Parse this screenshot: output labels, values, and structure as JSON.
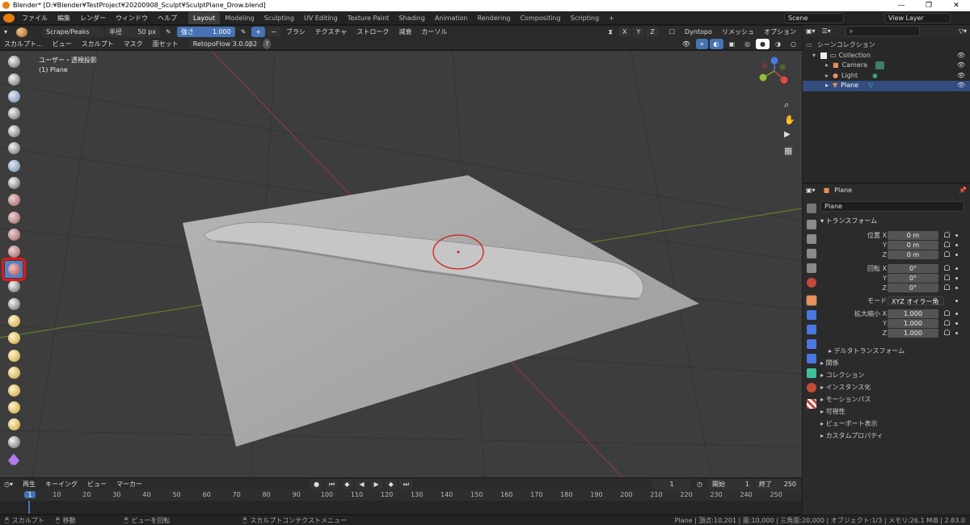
{
  "window": {
    "title": "Blender* [D:¥Blender¥TestProject¥20200908_Sculpt¥SculptPlane_Drow.blend]"
  },
  "menus": [
    "ファイル",
    "編集",
    "レンダー",
    "ウィンドウ",
    "ヘルプ"
  ],
  "workspaces": [
    "Layout",
    "Modeling",
    "Sculpting",
    "UV Editing",
    "Texture Paint",
    "Shading",
    "Animation",
    "Rendering",
    "Compositing",
    "Scripting"
  ],
  "active_workspace": "Layout",
  "scene": "Scene",
  "view_layer": "View Layer",
  "tool_header": {
    "brush": "Scrape/Peaks",
    "radius_label": "半径",
    "radius_value": "50 px",
    "strength_label": "強さ",
    "strength_value": "1.000",
    "plus": "+",
    "minus": "−",
    "menus": [
      "ブラシ",
      "テクスチャ",
      "ストローク",
      "減衰",
      "カーソル"
    ],
    "axes": [
      "X",
      "Y",
      "Z"
    ],
    "dyntopo": "Dyntopo",
    "remesh": "リメッシュ",
    "options": "オプション"
  },
  "viewport_header": {
    "mode": "スカルプト...",
    "menus": [
      "ビュー",
      "スカルプト",
      "マスク",
      "面セット"
    ],
    "addon": "RetopoFlow 3.0.0β2",
    "help": "?"
  },
  "overlay": {
    "view_name": "ユーザー・透視投影",
    "object": "(1) Plane"
  },
  "outliner": {
    "search_placeholder": "",
    "root": "シーンコレクション",
    "collection": "Collection",
    "items": [
      "Camera",
      "Light",
      "Plane"
    ],
    "selected": "Plane"
  },
  "properties": {
    "object_name": "Plane",
    "data_name": "Plane",
    "transform_title": "トランスフォーム",
    "location_label": "位置 X",
    "location": [
      "0 m",
      "0 m",
      "0 m"
    ],
    "rotation_label": "回転 X",
    "rotation": [
      "0°",
      "0°",
      "0°"
    ],
    "axis_y": "Y",
    "axis_z": "Z",
    "mode_label": "モード",
    "mode_value": "XYZ オイラー角",
    "scale_label": "拡大縮小 X",
    "scale": [
      "1.000",
      "1.000",
      "1.000"
    ],
    "delta": "デルタトランスフォーム",
    "panels": [
      "関係",
      "コレクション",
      "インスタンス化",
      "モーションパス",
      "可視性",
      "ビューポート表示",
      "カスタムプロパティ"
    ]
  },
  "timeline": {
    "menus": [
      "再生",
      "キーイング",
      "ビュー",
      "マーカー"
    ],
    "current_frame": "1",
    "start_label": "開始",
    "start": "1",
    "end_label": "終了",
    "end": "250",
    "ticks": [
      "1",
      "10",
      "20",
      "30",
      "40",
      "50",
      "60",
      "70",
      "80",
      "90",
      "100",
      "110",
      "120",
      "130",
      "140",
      "150",
      "160",
      "170",
      "180",
      "190",
      "200",
      "210",
      "220",
      "230",
      "240",
      "250"
    ]
  },
  "status": {
    "left": [
      "スカルプト",
      "移動",
      "ビューを回転",
      "スカルプトコンテクストメニュー"
    ],
    "right": "Plane | 頂点:10,201 | 面:10,000 | 三角面:20,000 | オブジェクト:1/3 | メモリ:26.1 MiB | 2.83.0"
  },
  "colors": {
    "accent": "#4772b3",
    "selection_outline": "#e0191a",
    "x_axis": "#e34a4a",
    "y_axis": "#8fbf3a",
    "z_axis": "#4a78e3"
  },
  "icons": [
    "blender-logo-icon",
    "brush-icon",
    "search-icon",
    "filter-icon",
    "eye-icon",
    "camera-icon",
    "light-icon",
    "mesh-icon",
    "zoom-icon",
    "hand-icon",
    "camera-view-icon",
    "grid-icon",
    "lock-icon",
    "wrench-icon",
    "play-icon"
  ]
}
